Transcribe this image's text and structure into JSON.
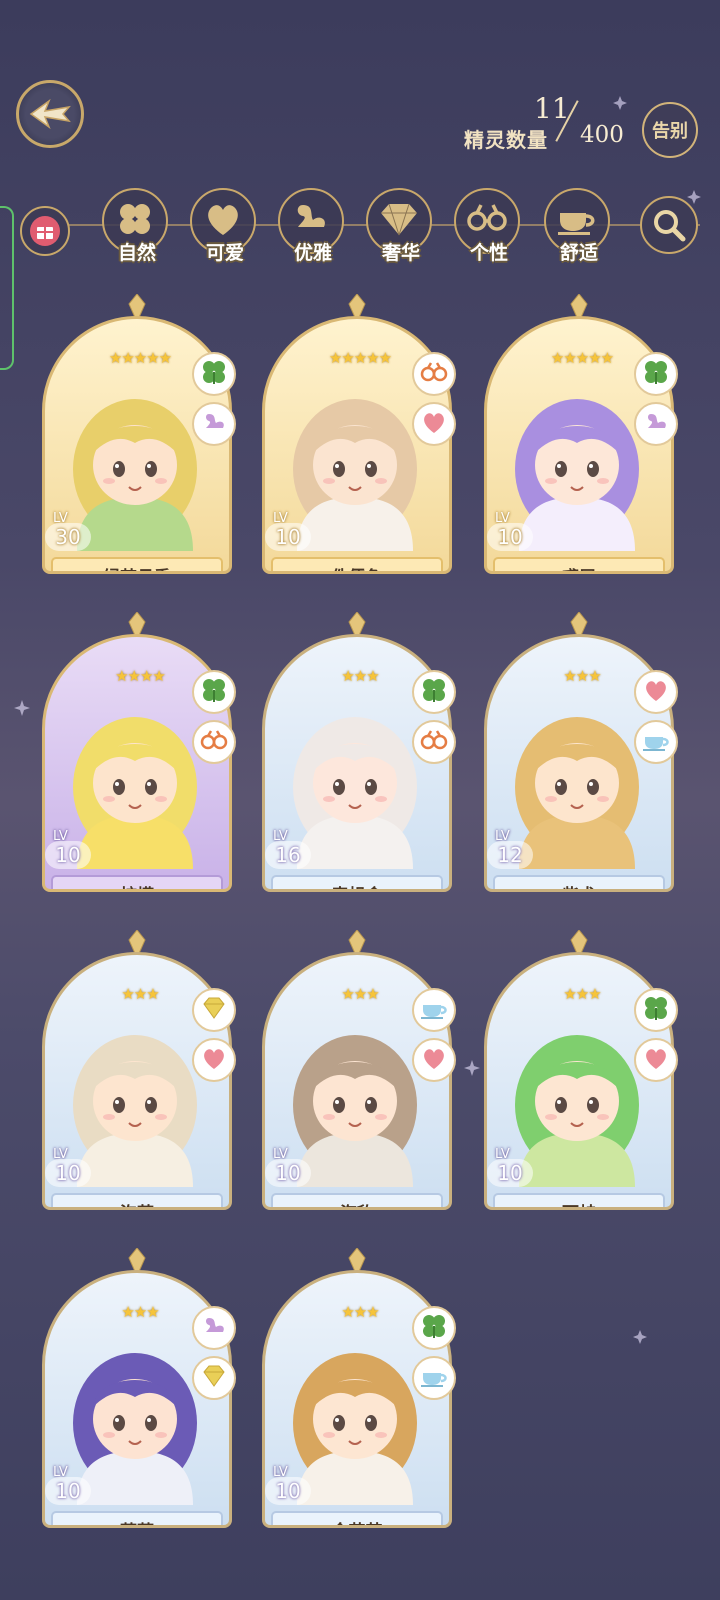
{
  "header": {
    "count_label": "精灵数量",
    "count_current": "11",
    "count_max": "400",
    "farewell_label": "告别"
  },
  "filters": [
    {
      "label": "自然",
      "icon": "clover-icon"
    },
    {
      "label": "可爱",
      "icon": "heart-icon"
    },
    {
      "label": "优雅",
      "icon": "swan-icon"
    },
    {
      "label": "奢华",
      "icon": "diamond-icon"
    },
    {
      "label": "个性",
      "icon": "glasses-icon"
    },
    {
      "label": "舒适",
      "icon": "teacup-icon"
    }
  ],
  "cards": [
    {
      "name": "绿茶月季",
      "lv_tag": "LV",
      "level": "30",
      "stars": "★★★★★",
      "rarity": "gold",
      "traits": [
        "clover-icon",
        "swan-icon"
      ],
      "hair": "#e8cf6a",
      "skin": "#fde3cc",
      "outfit": "#b5d98c"
    },
    {
      "name": "侏儒兔",
      "lv_tag": "LV",
      "level": "10",
      "stars": "★★★★★",
      "rarity": "gold",
      "traits": [
        "glasses-icon",
        "heart-icon"
      ],
      "hair": "#e6c9a6",
      "skin": "#fbe4d0",
      "outfit": "#f7f1ea"
    },
    {
      "name": "鸢尾",
      "lv_tag": "LV",
      "level": "10",
      "stars": "★★★★★",
      "rarity": "gold",
      "traits": [
        "clover-icon",
        "swan-icon"
      ],
      "hair": "#a98fe0",
      "skin": "#fde7d8",
      "outfit": "#f4eefc"
    },
    {
      "name": "柠檬",
      "lv_tag": "LV",
      "level": "10",
      "stars": "★★★★",
      "rarity": "purple",
      "traits": [
        "clover-icon",
        "glasses-icon"
      ],
      "hair": "#f1dd6a",
      "skin": "#fde4cc",
      "outfit": "#f7df68"
    },
    {
      "name": "毒蝇伞",
      "lv_tag": "LV",
      "level": "16",
      "stars": "★★★",
      "rarity": "blue",
      "traits": [
        "clover-icon",
        "glasses-icon"
      ],
      "hair": "#efe9e6",
      "skin": "#fde7dc",
      "outfit": "#f4f1ef"
    },
    {
      "name": "柴犬",
      "lv_tag": "LV",
      "level": "12",
      "stars": "★★★",
      "rarity": "blue",
      "traits": [
        "heart-icon",
        "teacup-icon"
      ],
      "hair": "#e5bd72",
      "skin": "#fde5cd",
      "outfit": "#e9c27a"
    },
    {
      "name": "泡芙",
      "lv_tag": "LV",
      "level": "10",
      "stars": "★★★",
      "rarity": "blue",
      "traits": [
        "diamond-icon",
        "heart-icon"
      ],
      "hair": "#e9dcc4",
      "skin": "#fde5cf",
      "outfit": "#f6efe2"
    },
    {
      "name": "海豹",
      "lv_tag": "LV",
      "level": "10",
      "stars": "★★★",
      "rarity": "blue",
      "traits": [
        "teacup-icon",
        "heart-icon"
      ],
      "hair": "#b9a18a",
      "skin": "#fde5d2",
      "outfit": "#ece6dd"
    },
    {
      "name": "雨蛙",
      "lv_tag": "LV",
      "level": "10",
      "stars": "★★★",
      "rarity": "blue",
      "traits": [
        "clover-icon",
        "heart-icon"
      ],
      "hair": "#7fcf6e",
      "skin": "#fde6d2",
      "outfit": "#cde7a0"
    },
    {
      "name": "蓝莓",
      "lv_tag": "LV",
      "level": "10",
      "stars": "★★★",
      "rarity": "blue",
      "traits": [
        "swan-icon",
        "diamond-icon"
      ],
      "hair": "#6b5bb6",
      "skin": "#fde3d2",
      "outfit": "#eef0f8"
    },
    {
      "name": "金花茶",
      "lv_tag": "LV",
      "level": "10",
      "stars": "★★★",
      "rarity": "blue",
      "traits": [
        "clover-icon",
        "teacup-icon"
      ],
      "hair": "#d8a65e",
      "skin": "#fde6d2",
      "outfit": "#f7f1e9"
    }
  ]
}
